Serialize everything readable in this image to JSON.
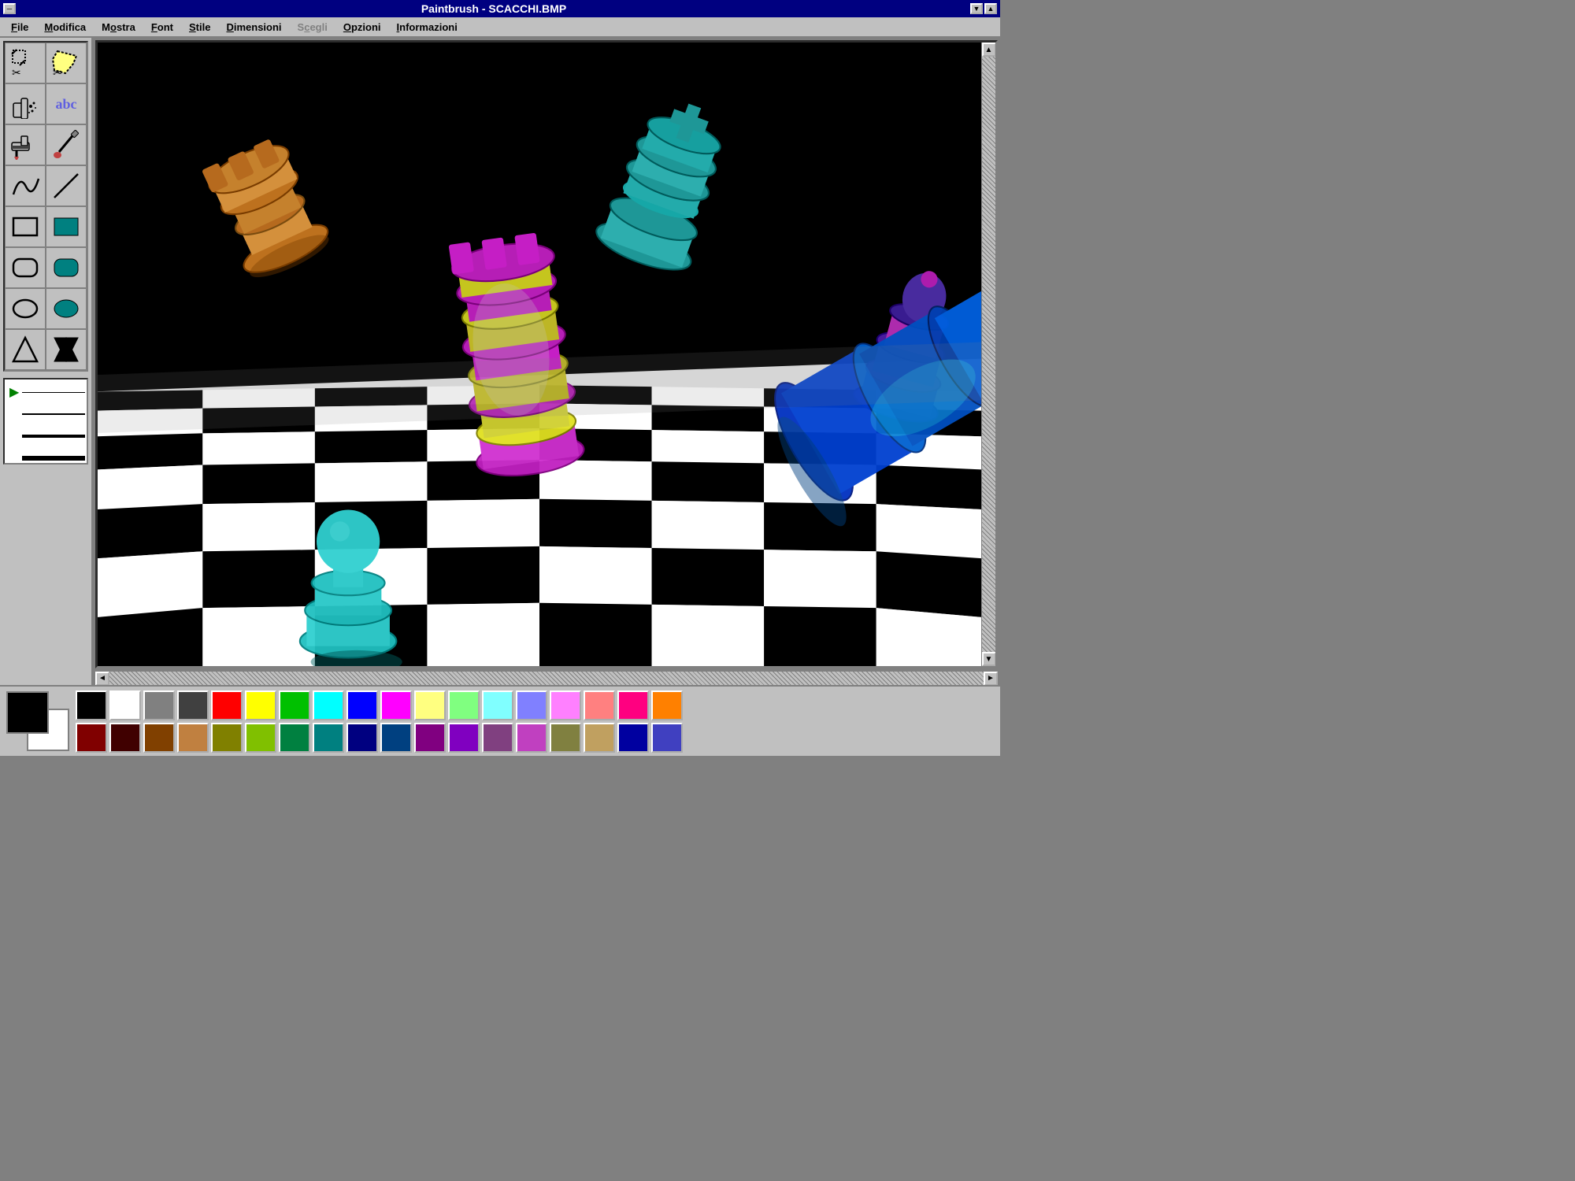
{
  "titleBar": {
    "title": "Paintbrush - SCACCHI.BMP",
    "minBtn": "▼",
    "maxBtn": "▲",
    "ctrlBtn": "─"
  },
  "menu": {
    "items": [
      {
        "label": "File",
        "underline": "F",
        "disabled": false
      },
      {
        "label": "Modifica",
        "underline": "M",
        "disabled": false
      },
      {
        "label": "Mostra",
        "underline": "o",
        "disabled": false
      },
      {
        "label": "Font",
        "underline": "F",
        "disabled": false
      },
      {
        "label": "Stile",
        "underline": "S",
        "disabled": false
      },
      {
        "label": "Dimensioni",
        "underline": "D",
        "disabled": false
      },
      {
        "label": "Scegli",
        "underline": "c",
        "disabled": true
      },
      {
        "label": "Opzioni",
        "underline": "O",
        "disabled": false
      },
      {
        "label": "Informazioni",
        "underline": "I",
        "disabled": false
      }
    ]
  },
  "tools": [
    {
      "id": "scissors",
      "icon": "✂",
      "label": "Scissors"
    },
    {
      "id": "scissors2",
      "icon": "✂",
      "label": "Scissors2"
    },
    {
      "id": "spray",
      "icon": "💨",
      "label": "Spray"
    },
    {
      "id": "text",
      "icon": "abc",
      "label": "Text"
    },
    {
      "id": "brush1",
      "icon": "🎨",
      "label": "Brush1"
    },
    {
      "id": "brush2",
      "icon": "🖌",
      "label": "Brush2"
    },
    {
      "id": "curve",
      "icon": "〜",
      "label": "Curve"
    },
    {
      "id": "line",
      "icon": "╱",
      "label": "Line"
    },
    {
      "id": "rect",
      "icon": "□",
      "label": "Rectangle"
    },
    {
      "id": "filled-rect",
      "icon": "■",
      "label": "FilledRect"
    },
    {
      "id": "rounded-rect",
      "icon": "▭",
      "label": "RoundedRect"
    },
    {
      "id": "filled-rounded",
      "icon": "▬",
      "label": "FilledRounded"
    },
    {
      "id": "ellipse",
      "icon": "○",
      "label": "Ellipse"
    },
    {
      "id": "filled-ellipse",
      "icon": "●",
      "label": "FilledEllipse"
    },
    {
      "id": "polygon",
      "icon": "◺",
      "label": "Polygon"
    },
    {
      "id": "filled-polygon",
      "icon": "◼",
      "label": "FilledPolygon"
    }
  ],
  "sizeSelectorLines": [
    {
      "height": 1
    },
    {
      "height": 2
    },
    {
      "height": 4
    },
    {
      "height": 6
    }
  ],
  "palette": {
    "foreground": "#000000",
    "background": "#ffffff",
    "colors": [
      [
        "#000000",
        "#808080",
        "#800000",
        "#ff0000",
        "#808000",
        "#ffff00",
        "#008000",
        "#00ff00",
        "#008080",
        "#00ffff",
        "#000080",
        "#0000ff",
        "#800080",
        "#ff00ff",
        "#c0c0c0",
        "#ffffff",
        "#ff8040",
        "#ff8000"
      ],
      [
        "#400000",
        "#804040",
        "#804000",
        "#c08040",
        "#408000",
        "#80c040",
        "#004040",
        "#408080",
        "#004080",
        "#4080c0",
        "#400080",
        "#8040c0",
        "#804080",
        "#c040c0",
        "#808040",
        "#c0c080",
        "#0000a0",
        "#8080ff"
      ]
    ]
  },
  "scrollbars": {
    "upArrow": "▲",
    "downArrow": "▼",
    "leftArrow": "◄",
    "rightArrow": "►"
  }
}
